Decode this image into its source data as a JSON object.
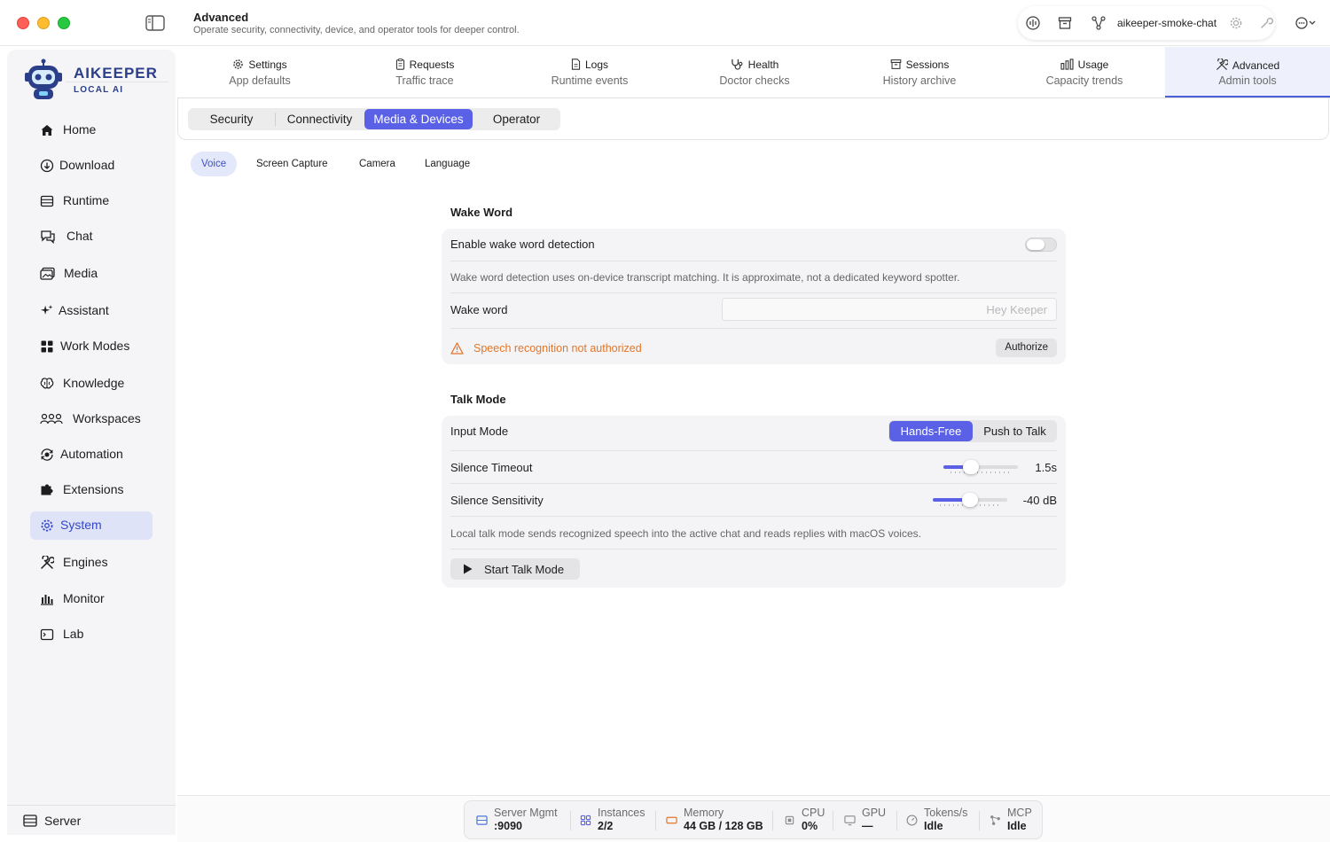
{
  "header": {
    "title": "Advanced",
    "subtitle": "Operate security, connectivity, device, and operator tools for deeper control.",
    "model_name": "aikeeper-smoke-chat"
  },
  "brand": {
    "name": "AIKEEPER",
    "tagline": "LOCAL AI"
  },
  "sidebar": {
    "items": [
      {
        "label": "Home",
        "icon": "house-icon"
      },
      {
        "label": "Download",
        "icon": "download-icon"
      },
      {
        "label": "Runtime",
        "icon": "runtime-icon"
      },
      {
        "label": "Chat",
        "icon": "chat-icon"
      },
      {
        "label": "Media",
        "icon": "media-icon"
      },
      {
        "label": "Assistant",
        "icon": "sparkle-icon"
      },
      {
        "label": "Work Modes",
        "icon": "grid-icon"
      },
      {
        "label": "Knowledge",
        "icon": "brain-icon"
      },
      {
        "label": "Workspaces",
        "icon": "people-icon"
      },
      {
        "label": "Automation",
        "icon": "automation-icon"
      },
      {
        "label": "Extensions",
        "icon": "puzzle-icon"
      },
      {
        "label": "System",
        "icon": "gear-icon",
        "active": true
      },
      {
        "label": "Engines",
        "icon": "tools-icon"
      },
      {
        "label": "Monitor",
        "icon": "bars-icon"
      },
      {
        "label": "Lab",
        "icon": "terminal-icon"
      }
    ],
    "footer": {
      "label": "Server",
      "icon": "server-icon"
    }
  },
  "top_tabs": [
    {
      "title": "Settings",
      "subtitle": "App defaults",
      "icon": "gear-icon"
    },
    {
      "title": "Requests",
      "subtitle": "Traffic trace",
      "icon": "clipboard-icon"
    },
    {
      "title": "Logs",
      "subtitle": "Runtime events",
      "icon": "document-icon"
    },
    {
      "title": "Health",
      "subtitle": "Doctor checks",
      "icon": "stethoscope-icon"
    },
    {
      "title": "Sessions",
      "subtitle": "History archive",
      "icon": "archive-icon"
    },
    {
      "title": "Usage",
      "subtitle": "Capacity trends",
      "icon": "chart-icon"
    },
    {
      "title": "Advanced",
      "subtitle": "Admin tools",
      "icon": "tools-icon",
      "active": true
    }
  ],
  "segments": [
    "Security",
    "Connectivity",
    "Media & Devices",
    "Operator"
  ],
  "active_segment": "Media & Devices",
  "sub_tabs": [
    "Voice",
    "Screen Capture",
    "Camera",
    "Language"
  ],
  "active_sub_tab": "Voice",
  "wake_word": {
    "section_title": "Wake Word",
    "enable_label": "Enable wake word detection",
    "enabled": false,
    "note": "Wake word detection uses on-device transcript matching. It is approximate, not a dedicated keyword spotter.",
    "field_label": "Wake word",
    "field_value": "",
    "field_placeholder": "Hey Keeper",
    "warning": "Speech recognition not authorized",
    "authorize_label": "Authorize"
  },
  "talk_mode": {
    "section_title": "Talk Mode",
    "input_mode_label": "Input Mode",
    "input_modes": [
      "Hands-Free",
      "Push to Talk"
    ],
    "selected_input_mode": "Hands-Free",
    "silence_timeout_label": "Silence Timeout",
    "silence_timeout_value": "1.5s",
    "silence_timeout_fraction": 0.33,
    "silence_sensitivity_label": "Silence Sensitivity",
    "silence_sensitivity_value": "-40 dB",
    "silence_sensitivity_fraction": 0.5,
    "note": "Local talk mode sends recognized speech into the active chat and reads replies with macOS voices.",
    "start_label": "Start Talk Mode"
  },
  "status_bar": [
    {
      "label": "Server Mgmt",
      "value": ":9090",
      "icon": "server-icon",
      "color": "#4a78d6"
    },
    {
      "label": "Instances",
      "value": "2/2",
      "icon": "grid-icon",
      "color": "#5a61e6"
    },
    {
      "label": "Memory",
      "value": "44 GB / 128 GB",
      "icon": "memory-icon",
      "color": "#e2762a"
    },
    {
      "label": "CPU",
      "value": "0%",
      "icon": "cpu-icon",
      "color": "#8a8a8e"
    },
    {
      "label": "GPU",
      "value": "—",
      "icon": "monitor-icon",
      "color": "#8a8a8e"
    },
    {
      "label": "Tokens/s",
      "value": "Idle",
      "icon": "gauge-icon",
      "color": "#8a8a8e"
    },
    {
      "label": "MCP",
      "value": "Idle",
      "icon": "network-icon",
      "color": "#8a8a8e"
    }
  ],
  "colors": {
    "accent": "#5a61e6",
    "warning": "#e2762a",
    "brand": "#2a3e8a"
  }
}
